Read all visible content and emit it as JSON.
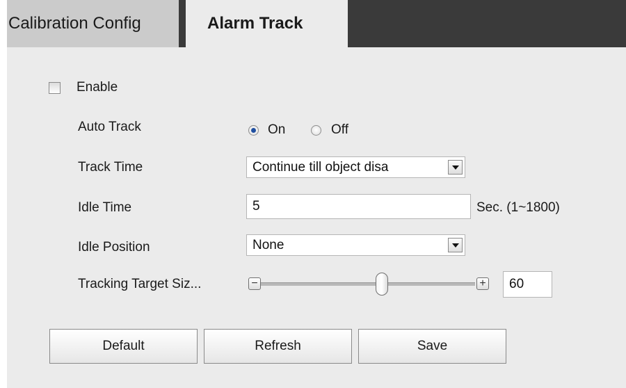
{
  "tabs": [
    {
      "label": "Calibration Config",
      "active": false
    },
    {
      "label": "Alarm Track",
      "active": true
    }
  ],
  "enable": {
    "label": "Enable",
    "checked": false
  },
  "auto_track": {
    "label": "Auto Track",
    "on_label": "On",
    "off_label": "Off",
    "selected": "On"
  },
  "track_time": {
    "label": "Track Time",
    "value": "Continue till object disa"
  },
  "idle_time": {
    "label": "Idle Time",
    "value": "5",
    "unit": "Sec. (1~1800)"
  },
  "idle_position": {
    "label": "Idle Position",
    "value": "None"
  },
  "tracking_target_size": {
    "label": "Tracking Target Siz...",
    "value": "60",
    "minus": "−",
    "plus": "+"
  },
  "buttons": {
    "default": "Default",
    "refresh": "Refresh",
    "save": "Save"
  },
  "colors": {
    "tab_bar": "#3a3a3a",
    "active_tab": "#ebebeb",
    "inactive_tab": "#cbcbcb",
    "panel": "#ebebeb",
    "radio_selected": "#1f4fa0"
  }
}
